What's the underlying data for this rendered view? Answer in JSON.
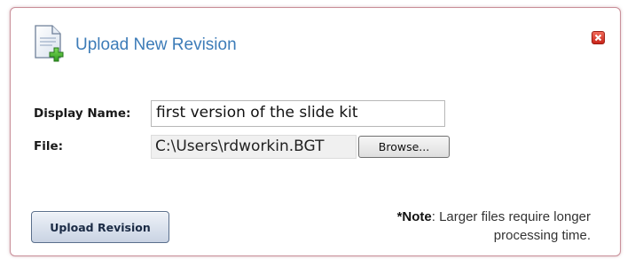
{
  "dialog": {
    "title": "Upload New Revision",
    "close_icon": "close-icon",
    "header_icon": "document-add-icon",
    "accent_color": "#3d7cb8",
    "close_color": "#d8342a"
  },
  "form": {
    "display_name_label": "Display Name:",
    "display_name_value": "first version of the slide kit",
    "file_label": "File:",
    "file_value": "C:\\Users\\rdworkin.BGT",
    "browse_label": "Browse..."
  },
  "footer": {
    "upload_button_label": "Upload Revision",
    "note_prefix": "*Note",
    "note_line1": ": Larger files require longer",
    "note_line2": "processing time."
  }
}
